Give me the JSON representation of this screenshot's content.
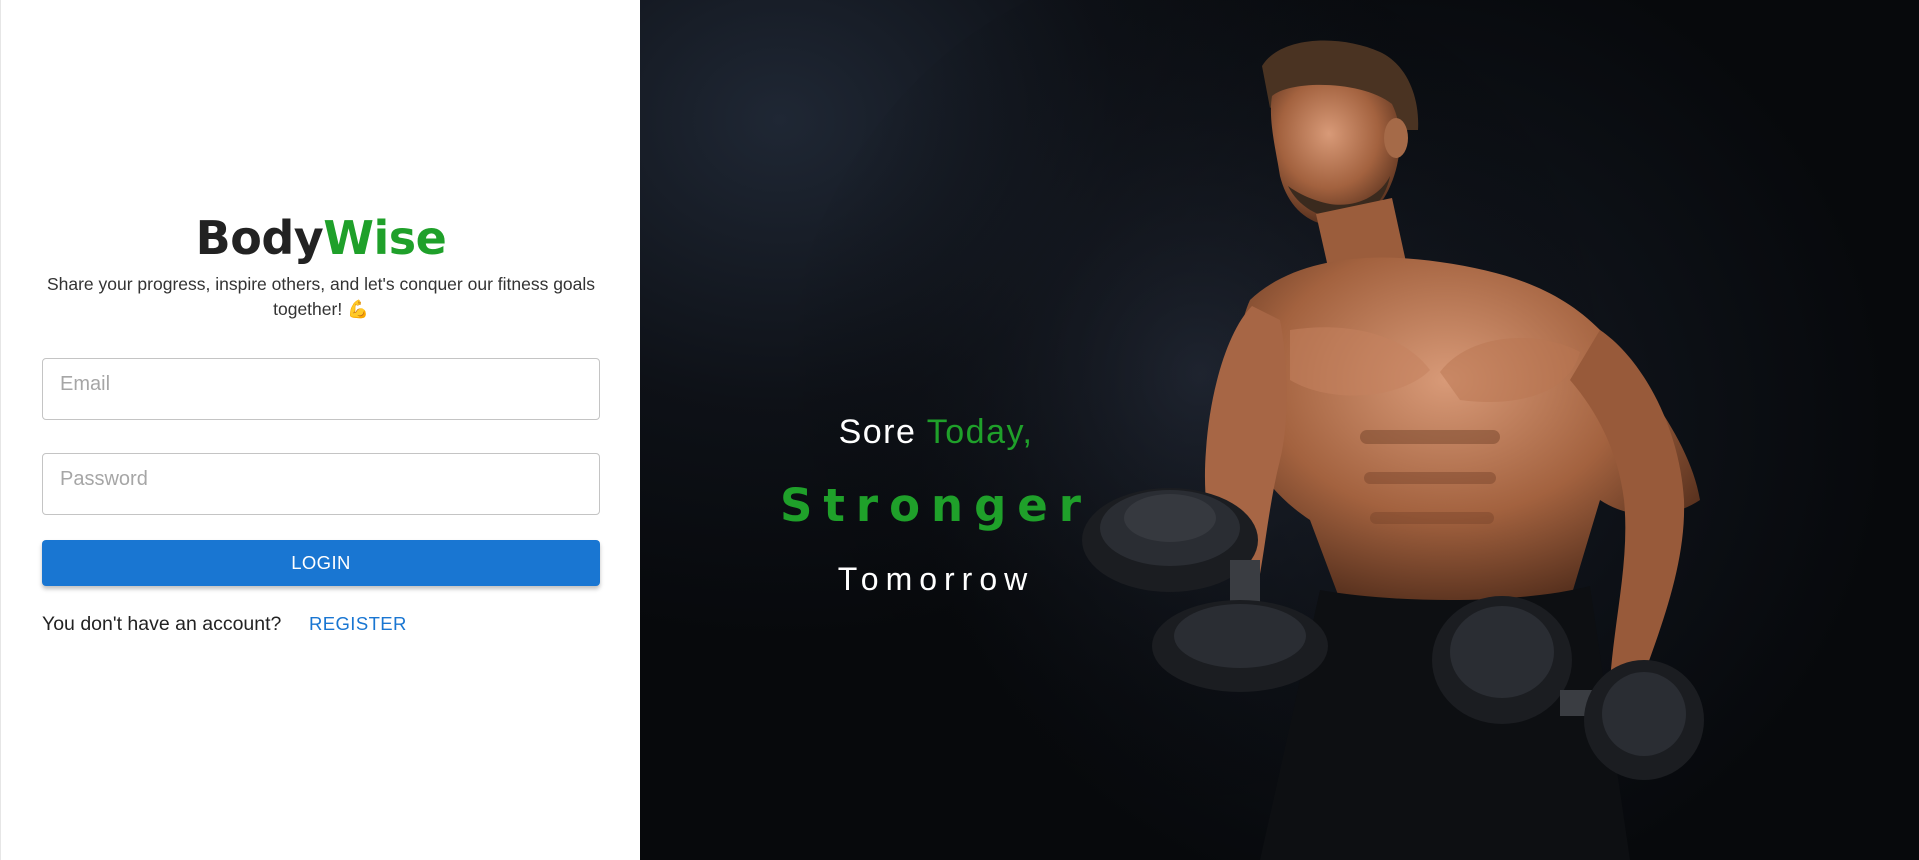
{
  "brand": {
    "part1": "Body",
    "part2": "Wise"
  },
  "tagline": "Share your progress, inspire others, and let's conquer our fitness goals together! 💪",
  "form": {
    "email_placeholder": "Email",
    "password_placeholder": "Password",
    "login_label": "LOGIN"
  },
  "register": {
    "prompt": "You don't have an account?",
    "link_label": "REGISTER"
  },
  "hero": {
    "slogan_line1_word1": "Sore",
    "slogan_line1_word2": "Today,",
    "slogan_line2": "Stronger",
    "slogan_line3": "Tomorrow"
  },
  "colors": {
    "accent_green": "#1fa02a",
    "primary_blue": "#1976d2",
    "hero_background": "#07090c"
  }
}
